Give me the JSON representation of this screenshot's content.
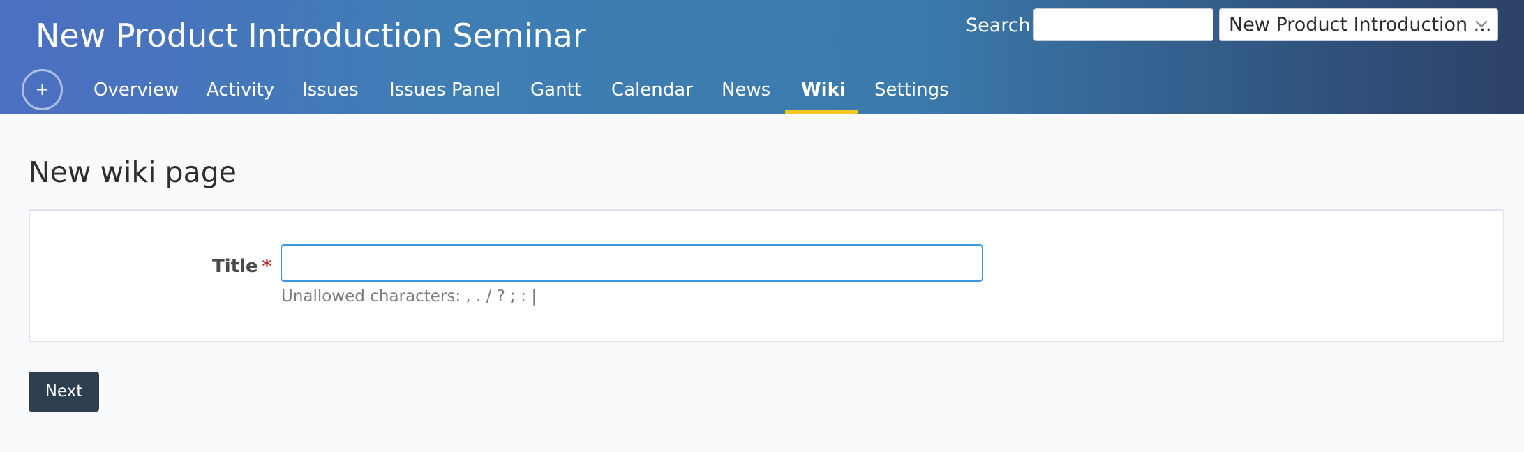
{
  "header": {
    "project_title": "New Product Introduction Seminar",
    "search_label": "Search:",
    "search_value": "",
    "project_select_value": "New Product Introduction ...",
    "add_button_label": "+"
  },
  "nav": {
    "tabs": [
      {
        "label": "Overview",
        "active": false
      },
      {
        "label": "Activity",
        "active": false
      },
      {
        "label": "Issues",
        "active": false
      },
      {
        "label": "Issues Panel",
        "active": false
      },
      {
        "label": "Gantt",
        "active": false
      },
      {
        "label": "Calendar",
        "active": false
      },
      {
        "label": "News",
        "active": false
      },
      {
        "label": "Wiki",
        "active": true
      },
      {
        "label": "Settings",
        "active": false
      }
    ]
  },
  "main": {
    "heading": "New wiki page",
    "form": {
      "title_label": "Title",
      "required_marker": "*",
      "title_value": "",
      "hint": "Unallowed characters: , . / ? ; : |"
    },
    "next_button_label": "Next"
  },
  "colors": {
    "accent_underline": "#f3c623",
    "next_button_bg": "#2d3e50",
    "input_focus_border": "#3b95e0",
    "required_star": "#b32424"
  }
}
